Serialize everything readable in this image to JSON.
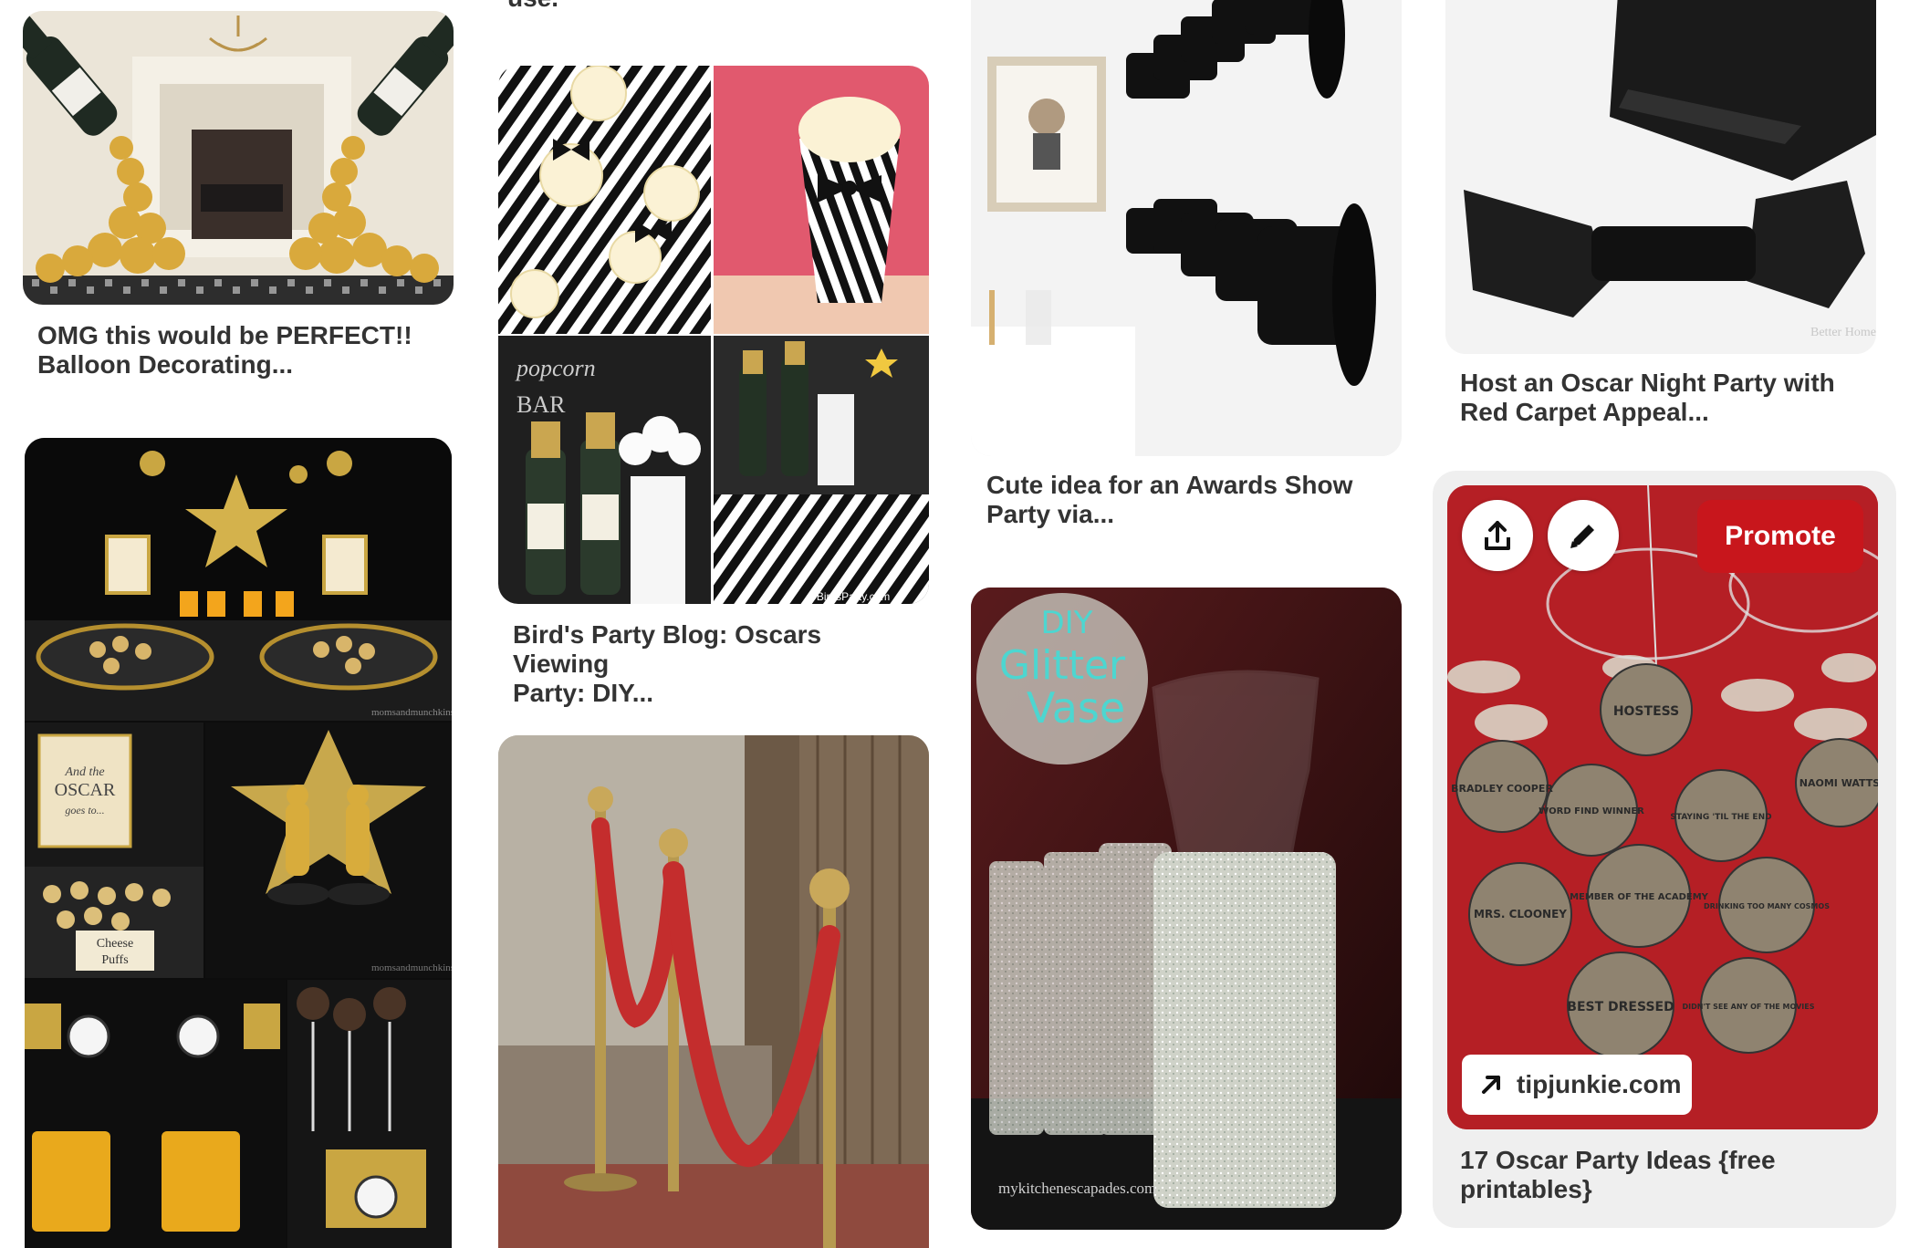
{
  "top_fragment": "use.",
  "pins": [
    {
      "id": "balloons",
      "title": "OMG this would be PERFECT!!\nBalloon Decorating..."
    },
    {
      "id": "candy-table",
      "title": ""
    },
    {
      "id": "popcorn",
      "title": "Bird's Party Blog: Oscars Viewing\nParty: DIY..."
    },
    {
      "id": "red-ropes",
      "title": ""
    },
    {
      "id": "top-hats",
      "title": "Cute idea for an Awards Show\nParty via..."
    },
    {
      "id": "glitter-vase",
      "title": ""
    },
    {
      "id": "bow-ties",
      "title": "Host an Oscar Night Party with\nRed Carpet Appeal..."
    },
    {
      "id": "oscar-party",
      "title": "17 Oscar Party Ideas {free\nprintables}"
    }
  ],
  "image_text": {
    "popcorn_credit": "©BirdsParty.com",
    "candy_credit_1": "momsandmunchkins.ca",
    "candy_credit_2": "momsandmunchkins.ca",
    "glitter_title_1": "DIY",
    "glitter_title_2": "Glitter",
    "glitter_title_3": "Vase",
    "glitter_credit": "mykitchenescapades.com",
    "bowtie_credit": "Better Homes",
    "cheese_label": "Cheese Puffs",
    "oscar_sign": "And the OSCAR goes to...",
    "tags": [
      "HOSTESS",
      "BRADLEY COOPER",
      "WORD FIND WINNER",
      "STAYING 'TIL THE END",
      "NAOMI WATTS",
      "DRINKING TOO MANY COSMOS",
      "MEMBER OF THE ACADEMY",
      "MRS. CLOONEY",
      "BEST DRESSED",
      "DIDN'T SEE ANY OF THE MOVIES"
    ]
  },
  "hover_actions": {
    "share_icon": "share-icon",
    "edit_icon": "pencil-icon",
    "promote_label": "Promote",
    "link_icon": "arrow-up-right-icon",
    "link_domain": "tipjunkie.com"
  },
  "colors": {
    "promote": "#c8161c",
    "hover_card_bg": "#efefef",
    "title_text": "#333333"
  }
}
